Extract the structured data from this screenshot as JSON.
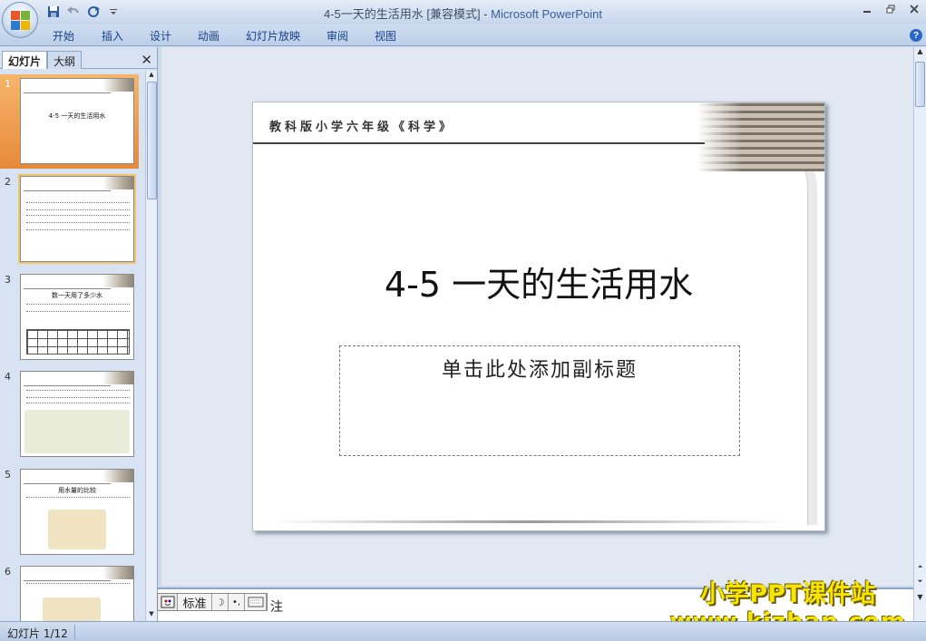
{
  "window": {
    "doc_title": "4-5一天的生活用水 [兼容模式]",
    "separator": " - ",
    "app_name": "Microsoft PowerPoint"
  },
  "qat": {
    "items": [
      "save-icon",
      "undo-icon",
      "redo-icon",
      "customize-icon"
    ]
  },
  "ribbon": {
    "tabs": [
      "开始",
      "插入",
      "设计",
      "动画",
      "幻灯片放映",
      "审阅",
      "视图"
    ],
    "help": "?"
  },
  "left_pane": {
    "tab_slides": "幻灯片",
    "tab_outline": "大纲",
    "close": "✕",
    "thumbnails": [
      {
        "num": "1",
        "title": "4-5 一天的生活用水"
      },
      {
        "num": "2",
        "title": ""
      },
      {
        "num": "3",
        "title": "数一天用了多少水"
      },
      {
        "num": "4",
        "title": ""
      },
      {
        "num": "5",
        "title": "用水量的比较"
      },
      {
        "num": "6",
        "title": ""
      }
    ]
  },
  "slide": {
    "header": "教科版小学六年级《科学》",
    "title": "4-5 一天的生活用水",
    "subtitle_placeholder": "单击此处添加副标题"
  },
  "notes": {
    "text": "注"
  },
  "ime": {
    "mode": "标准",
    "moon": "☽",
    "punct": "•,"
  },
  "watermark": {
    "line1": "小学PPT课件站",
    "line2": "www.kjzhan.com"
  },
  "status": {
    "slide_info": "幻灯片 1/12"
  },
  "colors": {
    "accent": "#15428b",
    "selection": "#f0a050"
  }
}
